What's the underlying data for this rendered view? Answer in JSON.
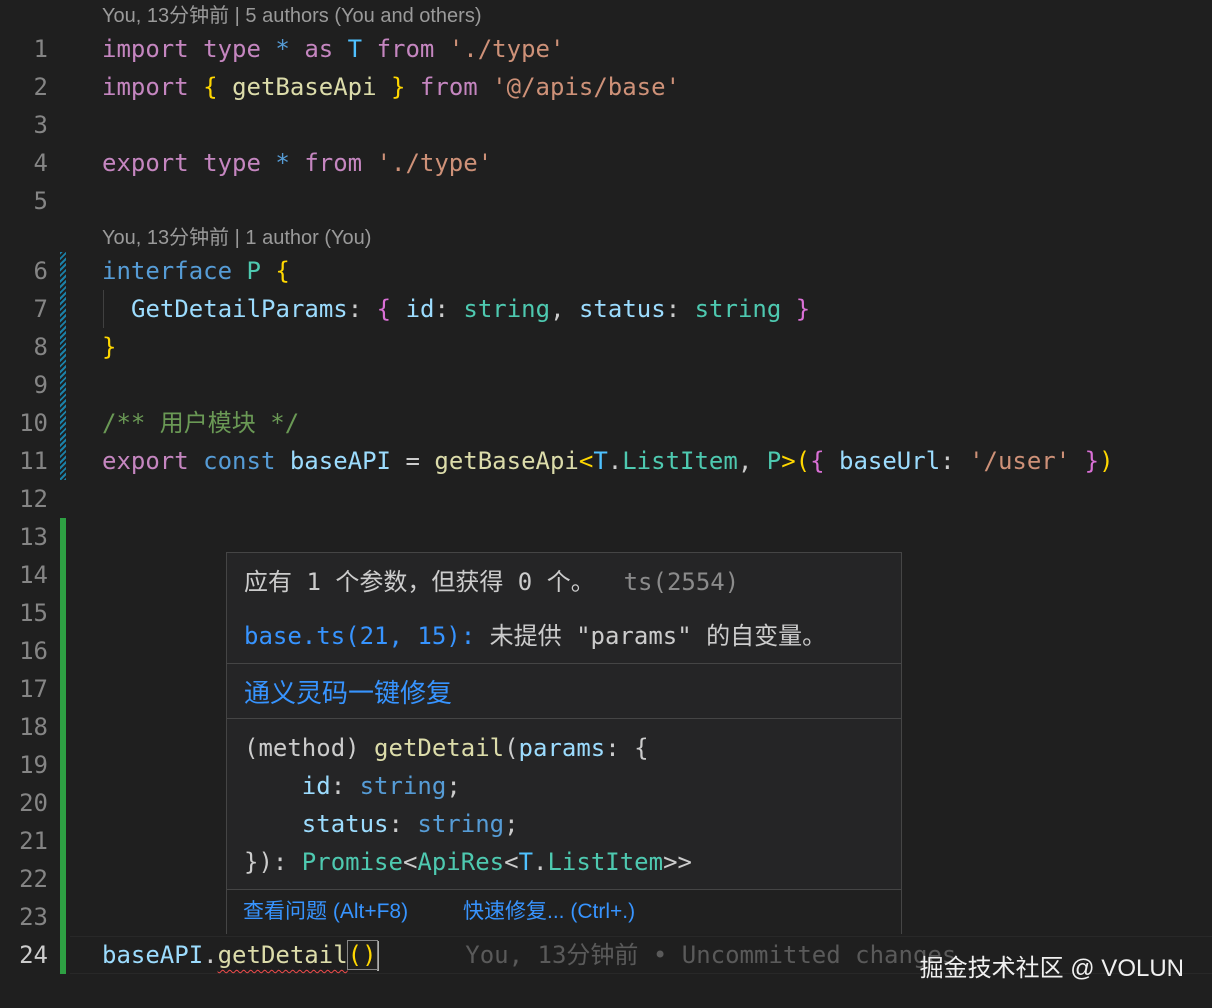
{
  "codelens": {
    "top": "You, 13分钟前 | 5 authors (You and others)",
    "interface": "You, 13分钟前 | 1 author (You)"
  },
  "line_numbers": [
    "1",
    "2",
    "3",
    "4",
    "5",
    "6",
    "7",
    "8",
    "9",
    "10",
    "11",
    "12",
    "13",
    "14",
    "15",
    "16",
    "17",
    "18",
    "19",
    "20",
    "21",
    "22",
    "23",
    "24"
  ],
  "code": {
    "l1": {
      "import": "import",
      "type": "type",
      "star": "*",
      "as": "as",
      "ns": "T",
      "from": "from",
      "path": "'./type'"
    },
    "l2": {
      "import": "import",
      "open": "{",
      "name": "getBaseApi",
      "close": "}",
      "from": "from",
      "path": "'@/apis/base'"
    },
    "l4": {
      "export": "export",
      "type": "type",
      "star": "*",
      "from": "from",
      "path": "'./type'"
    },
    "l6": {
      "interface": "interface",
      "name": "P",
      "open": "{"
    },
    "l7": {
      "prop": "GetDetailParams",
      "colon": ":",
      "open": "{",
      "id": "id",
      "c1": ":",
      "t1": "string",
      "comma": ",",
      "status": "status",
      "c2": ":",
      "t2": "string",
      "close": "}"
    },
    "l8": {
      "close": "}"
    },
    "l10": {
      "comment": "/** 用户模块 */"
    },
    "l11": {
      "export": "export",
      "const": "const",
      "var": "baseAPI",
      "eq": "=",
      "fn": "getBaseApi",
      "lt": "<",
      "ns": "T",
      "dot": ".",
      "item": "ListItem",
      "comma": ",",
      "p": "P",
      "gt": ">",
      "paren_open": "(",
      "brace_open": "{",
      "key": "baseUrl",
      "colon": ":",
      "val": "'/user'",
      "brace_close": "}",
      "paren_close": ")"
    },
    "l24": {
      "obj": "baseAPI",
      "dot": ".",
      "method": "getDetail",
      "parens": "()",
      "blame": "You, 13分钟前 • Uncommitted changes"
    }
  },
  "hover": {
    "message": "应有 1 个参数，但获得 0 个。",
    "code": "ts(2554)",
    "related_link": "base.ts(21, 15):",
    "related_text": " 未提供 \"params\" 的自变量。",
    "ai_fix": "通义灵码一键修复",
    "signature": {
      "l1_a": "(method) ",
      "l1_fn": "getDetail",
      "l1_p": "(",
      "l1_param": "params",
      "l1_rest": ": {",
      "l2_key": "id",
      "l2_rest": ": ",
      "l2_type": "string",
      "l2_end": ";",
      "l3_key": "status",
      "l3_rest": ": ",
      "l3_type": "string",
      "l3_end": ";",
      "l4_a": "}): ",
      "l4_promise": "Promise",
      "l4_lt": "<",
      "l4_apires": "ApiRes",
      "l4_lt2": "<",
      "l4_ns": "T",
      "l4_dot": ".",
      "l4_item": "ListItem",
      "l4_gt": ">>"
    },
    "action_view": "查看问题 (Alt+F8)",
    "action_fix": "快速修复... (Ctrl+.)"
  },
  "watermark": "掘金技术社区 @ VOLUN",
  "colors": {
    "background": "#1f1f1f",
    "keyword": "#c586c0",
    "string": "#ce9178",
    "type": "#4ec9b0",
    "link": "#3794ff",
    "gutter_added": "#2ea043",
    "gutter_modified": "#1b81a8"
  }
}
